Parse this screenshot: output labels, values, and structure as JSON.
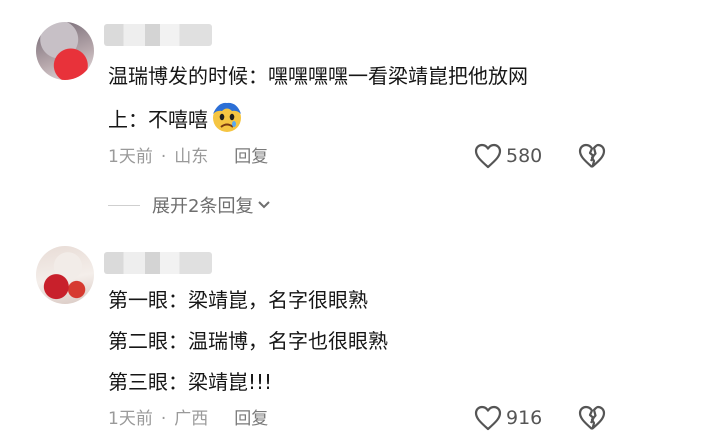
{
  "comments": [
    {
      "lines": [
        "温瑞博发的时候：嘿嘿嘿嘿一看梁靖崑把他放网",
        "上：不嘻嘻"
      ],
      "emoji": "sad-face-emoji",
      "time": "1天前",
      "location": "山东",
      "reply_label": "回复",
      "likes": "580"
    },
    {
      "lines": [
        "第一眼：梁靖崑，名字很眼熟",
        "第二眼：温瑞博，名字也很眼熟",
        "第三眼：梁靖崑!!!"
      ],
      "time": "1天前",
      "location": "广西",
      "reply_label": "回复",
      "likes": "916"
    }
  ],
  "expand_replies_label": "展开2条回复",
  "icons": {
    "like": "heart-outline-icon",
    "dislike": "broken-heart-icon",
    "expand": "chevron-down-icon"
  },
  "colors": {
    "text": "#161616",
    "meta": "#9a9a9a",
    "icon": "#555555"
  }
}
